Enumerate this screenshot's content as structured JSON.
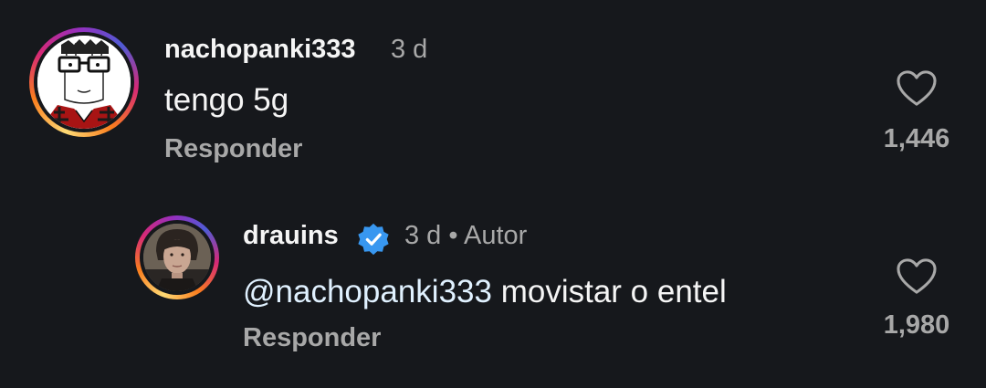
{
  "comments": [
    {
      "username": "nachopanki333",
      "time": "3 d",
      "text": "tengo 5g",
      "reply_label": "Responder",
      "likes": "1,446"
    },
    {
      "username": "drauins",
      "verified": true,
      "meta": "3 d • Autor",
      "mention": "@nachopanki333",
      "text": " movistar o entel",
      "reply_label": "Responder",
      "likes": "1,980"
    }
  ],
  "colors": {
    "background": "#16181c",
    "text_primary": "#f5f5f5",
    "text_secondary": "#a8a8a8",
    "verified_badge": "#3897f0",
    "mention": "#e0f1ff"
  },
  "icons": {
    "like": "heart-icon",
    "verified": "verified-badge-icon"
  }
}
